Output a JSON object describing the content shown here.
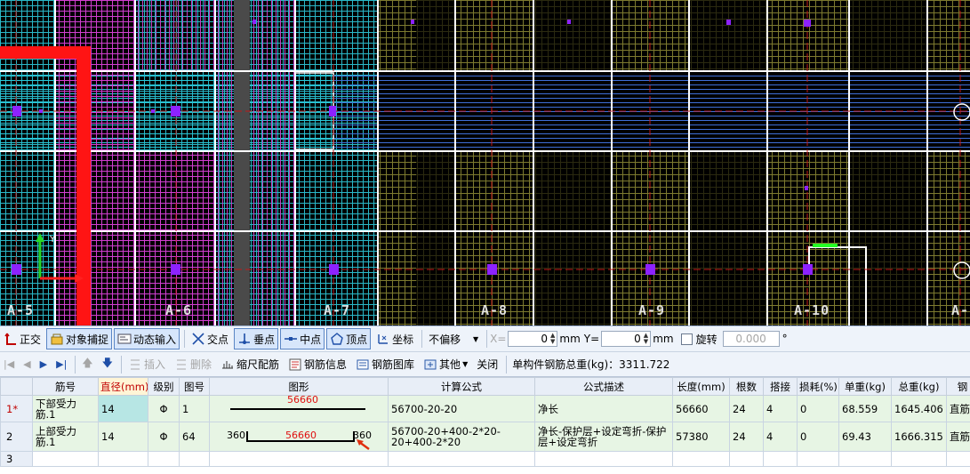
{
  "cad": {
    "axis_labels": [
      "A-5",
      "A-6",
      "A-7",
      "A-8",
      "A-9",
      "A-10",
      "A-"
    ],
    "ucs_y": "Y"
  },
  "toolbar1": {
    "orthogonal": "正交",
    "object_snap": "对象捕捉",
    "dynamic_input": "动态输入",
    "intersection": "交点",
    "perpendicular": "垂点",
    "midpoint": "中点",
    "vertex": "顶点",
    "coordinate": "坐标",
    "offset_select": "不偏移",
    "x_label": "X=",
    "x_value": "0",
    "x_unit": "mm",
    "y_label": "Y=",
    "y_value": "0",
    "y_unit": "mm",
    "rotate_label": "旋转",
    "rotate_value": "0.000",
    "degree": "°"
  },
  "toolbar2": {
    "insert": "插入",
    "delete": "删除",
    "scale_rebar": "缩尺配筋",
    "rebar_info": "钢筋信息",
    "rebar_library": "钢筋图库",
    "other": "其他",
    "close": "关闭",
    "total_weight": "单构件钢筋总重(kg)：3311.722"
  },
  "table": {
    "headers": [
      "筋号",
      "直径(mm)",
      "级别",
      "图号",
      "图形",
      "计算公式",
      "公式描述",
      "长度(mm)",
      "根数",
      "搭接",
      "损耗(%)",
      "单重(kg)",
      "总重(kg)",
      "钢"
    ],
    "rows": [
      {
        "idx": "1*",
        "name": "下部受力筋.1",
        "diameter": "14",
        "grade": "Φ",
        "fig": "1",
        "shape_mid": "56660",
        "shape_left": "",
        "shape_right": "",
        "formula": "56700-20-20",
        "desc": "净长",
        "length": "56660",
        "count": "24",
        "lap": "4",
        "loss": "0",
        "unit_w": "68.559",
        "total_w": "1645.406",
        "hook": "直筋"
      },
      {
        "idx": "2",
        "name": "上部受力筋.1",
        "diameter": "14",
        "grade": "Φ",
        "fig": "64",
        "shape_mid": "56660",
        "shape_left": "360",
        "shape_right": "360",
        "formula": "56700-20+400-2*20-20+400-2*20",
        "desc": "净长-保护层+设定弯折-保护层+设定弯折",
        "length": "57380",
        "count": "24",
        "lap": "4",
        "loss": "0",
        "unit_w": "69.43",
        "total_w": "1666.315",
        "hook": "直筋"
      },
      {
        "idx": "3",
        "name": "",
        "diameter": "",
        "grade": "",
        "fig": "",
        "shape_mid": "",
        "shape_left": "",
        "shape_right": "",
        "formula": "",
        "desc": "",
        "length": "",
        "count": "",
        "lap": "",
        "loss": "",
        "unit_w": "",
        "total_w": "",
        "hook": ""
      }
    ]
  }
}
